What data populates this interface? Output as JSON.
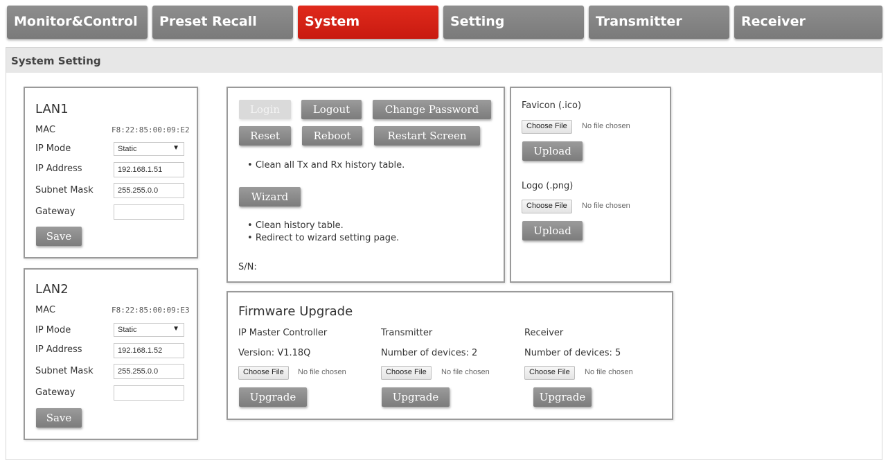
{
  "tabs": [
    {
      "label": "Monitor&Control"
    },
    {
      "label": "Preset Recall"
    },
    {
      "label": "System"
    },
    {
      "label": "Setting"
    },
    {
      "label": "Transmitter"
    },
    {
      "label": "Receiver"
    }
  ],
  "active_tab": "System",
  "accent_color": "#d9231a",
  "panel_title": "System Setting",
  "lan1": {
    "title": "LAN1",
    "mac_label": "MAC",
    "mac": "F8:22:85:00:09:E2",
    "ip_mode_label": "IP Mode",
    "ip_mode": "Static",
    "ip_address_label": "IP Address",
    "ip_address": "192.168.1.51",
    "subnet_label": "Subnet Mask",
    "subnet": "255.255.0.0",
    "gateway_label": "Gateway",
    "gateway": "",
    "save_label": "Save"
  },
  "lan2": {
    "title": "LAN2",
    "mac_label": "MAC",
    "mac": "F8:22:85:00:09:E3",
    "ip_mode_label": "IP Mode",
    "ip_mode": "Static",
    "ip_address_label": "IP Address",
    "ip_address": "192.168.1.52",
    "subnet_label": "Subnet Mask",
    "subnet": "255.255.0.0",
    "gateway_label": "Gateway",
    "gateway": "",
    "save_label": "Save"
  },
  "control": {
    "login_label": "Login",
    "logout_label": "Logout",
    "change_password_label": "Change Password",
    "reset_label": "Reset",
    "reboot_label": "Reboot",
    "restart_screen_label": "Restart Screen",
    "reset_note": "Clean all Tx and Rx history table.",
    "wizard_label": "Wizard",
    "wizard_notes": [
      "Clean history table.",
      "Redirect to wizard setting page."
    ],
    "sn_label": "S/N:"
  },
  "branding": {
    "favicon_label": "Favicon (.ico)",
    "logo_label": "Logo (.png)",
    "choose_file_label": "Choose File",
    "no_file_label": "No file chosen",
    "upload_label": "Upload"
  },
  "firmware": {
    "title": "Firmware Upgrade",
    "choose_file_label": "Choose File",
    "no_file_label": "No file chosen",
    "upgrade_label": "Upgrade",
    "columns": [
      {
        "heading": "IP Master Controller",
        "info": "Version: V1.18Q"
      },
      {
        "heading": "Transmitter",
        "info": "Number of devices: 2"
      },
      {
        "heading": "Receiver",
        "info": "Number of devices: 5"
      }
    ]
  }
}
